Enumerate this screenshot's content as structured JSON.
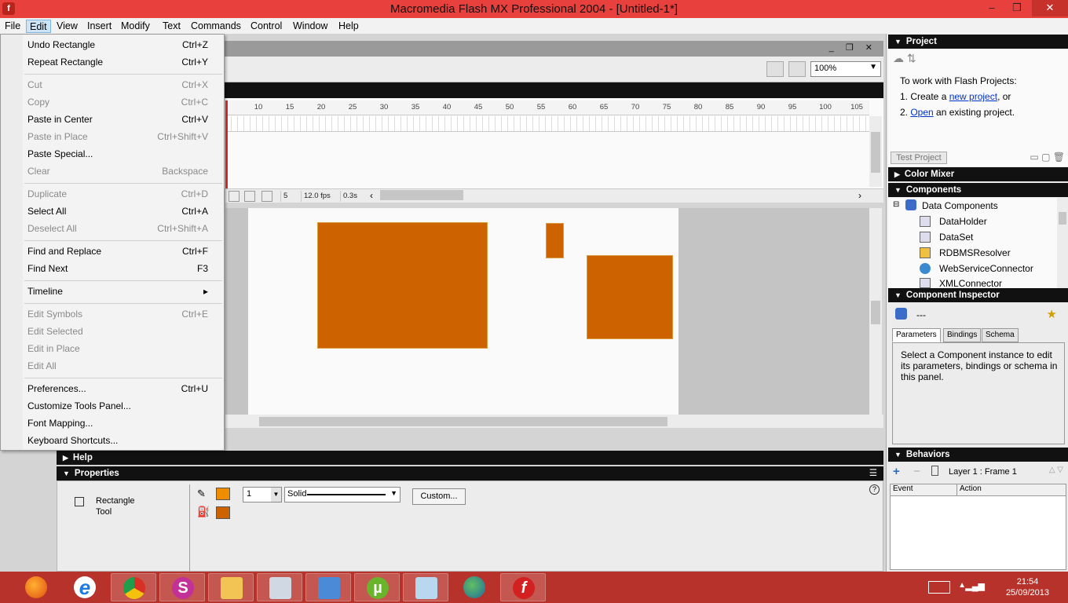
{
  "window": {
    "title": "Macromedia Flash MX Professional 2004 - [Untitled-1*]",
    "app_icon_letter": "f",
    "controls": {
      "minimize": "–",
      "restore": "❐",
      "close": "✕"
    }
  },
  "menubar": {
    "items": [
      "File",
      "Edit",
      "View",
      "Insert",
      "Modify",
      "Text",
      "Commands",
      "Control",
      "Window",
      "Help"
    ],
    "active_index": 1
  },
  "edit_menu": {
    "items": [
      {
        "label": "Undo Rectangle",
        "shortcut": "Ctrl+Z",
        "enabled": true
      },
      {
        "label": "Repeat Rectangle",
        "shortcut": "Ctrl+Y",
        "enabled": true
      },
      {
        "label": "Cut",
        "shortcut": "Ctrl+X",
        "enabled": false
      },
      {
        "label": "Copy",
        "shortcut": "Ctrl+C",
        "enabled": false
      },
      {
        "label": "Paste in Center",
        "shortcut": "Ctrl+V",
        "enabled": true
      },
      {
        "label": "Paste in Place",
        "shortcut": "Ctrl+Shift+V",
        "enabled": false
      },
      {
        "label": "Paste Special...",
        "shortcut": "",
        "enabled": true
      },
      {
        "label": "Clear",
        "shortcut": "Backspace",
        "enabled": false
      },
      {
        "label": "Duplicate",
        "shortcut": "Ctrl+D",
        "enabled": false
      },
      {
        "label": "Select All",
        "shortcut": "Ctrl+A",
        "enabled": true
      },
      {
        "label": "Deselect All",
        "shortcut": "Ctrl+Shift+A",
        "enabled": false
      },
      {
        "label": "Find and Replace",
        "shortcut": "Ctrl+F",
        "enabled": true
      },
      {
        "label": "Find Next",
        "shortcut": "F3",
        "enabled": true
      },
      {
        "label": "Timeline",
        "shortcut": "▸",
        "enabled": true
      },
      {
        "label": "Edit Symbols",
        "shortcut": "Ctrl+E",
        "enabled": false
      },
      {
        "label": "Edit Selected",
        "shortcut": "",
        "enabled": false
      },
      {
        "label": "Edit in Place",
        "shortcut": "",
        "enabled": false
      },
      {
        "label": "Edit All",
        "shortcut": "",
        "enabled": false
      },
      {
        "label": "Preferences...",
        "shortcut": "Ctrl+U",
        "enabled": true
      },
      {
        "label": "Customize Tools Panel...",
        "shortcut": "",
        "enabled": true
      },
      {
        "label": "Font Mapping...",
        "shortcut": "",
        "enabled": true
      },
      {
        "label": "Keyboard Shortcuts...",
        "shortcut": "",
        "enabled": true
      }
    ]
  },
  "document": {
    "zoom": "100%",
    "timeline": {
      "ruler_ticks": [
        "10",
        "15",
        "20",
        "25",
        "30",
        "35",
        "40",
        "45",
        "50",
        "55",
        "60",
        "65",
        "70",
        "75",
        "80",
        "85",
        "90",
        "95",
        "100",
        "105"
      ],
      "current_frame": "5",
      "frame_rate": "12.0 fps",
      "elapsed": "0.3s"
    },
    "stage_fill_color": "#cc6200"
  },
  "panels": {
    "help": "Help",
    "properties": {
      "title": "Properties",
      "tool_name": "Rectangle",
      "tool_suffix": "Tool",
      "stroke_color": "#f08c00",
      "fill_color": "#cc6200",
      "stroke_height": "1",
      "stroke_style": "Solid",
      "custom_button": "Custom..."
    }
  },
  "right_panels": {
    "project": {
      "title": "Project",
      "intro": "To work with Flash Projects:",
      "line1_prefix": "1. Create a ",
      "line1_link": "new project",
      "line1_suffix": ", or",
      "line2_prefix": "2. ",
      "line2_link": "Open",
      "line2_suffix": " an existing project.",
      "test_button": "Test Project"
    },
    "color_mixer": "Color Mixer",
    "components": {
      "title": "Components",
      "root": "Data Components",
      "items": [
        "DataHolder",
        "DataSet",
        "RDBMSResolver",
        "WebServiceConnector",
        "XMLConnector"
      ]
    },
    "component_inspector": {
      "title": "Component Inspector",
      "name_value": "---",
      "tabs": [
        "Parameters",
        "Bindings",
        "Schema"
      ],
      "message": "Select a Component instance to edit its parameters, bindings or schema in this panel."
    },
    "behaviors": {
      "title": "Behaviors",
      "context": "Layer 1 : Frame 1",
      "col_event": "Event",
      "col_action": "Action"
    }
  },
  "taskbar": {
    "apps": [
      "firefox-icon",
      "internet-explorer-icon",
      "chrome-icon",
      "app-s-icon",
      "file-explorer-icon",
      "monitor-icon",
      "control-panel-icon",
      "utorrent-icon",
      "notes-icon",
      "globe-arrow-icon",
      "flash-icon"
    ],
    "time": "21:54",
    "date": "25/09/2013"
  }
}
